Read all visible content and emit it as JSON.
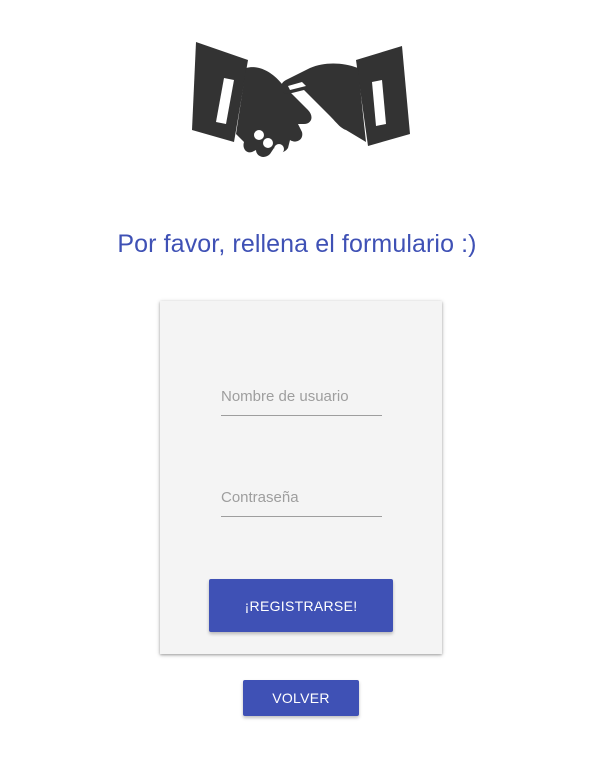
{
  "header": {
    "logo_icon": "handshake-icon",
    "title": "Por favor, rellena el formulario :)"
  },
  "form": {
    "username": {
      "placeholder": "Nombre de usuario",
      "value": ""
    },
    "password": {
      "placeholder": "Contraseña",
      "value": ""
    },
    "register_label": "¡REGISTRARSE!"
  },
  "back_label": "VOLVER",
  "colors": {
    "accent": "#3f51b5",
    "icon": "#333333",
    "card_background": "#f4f4f4"
  }
}
